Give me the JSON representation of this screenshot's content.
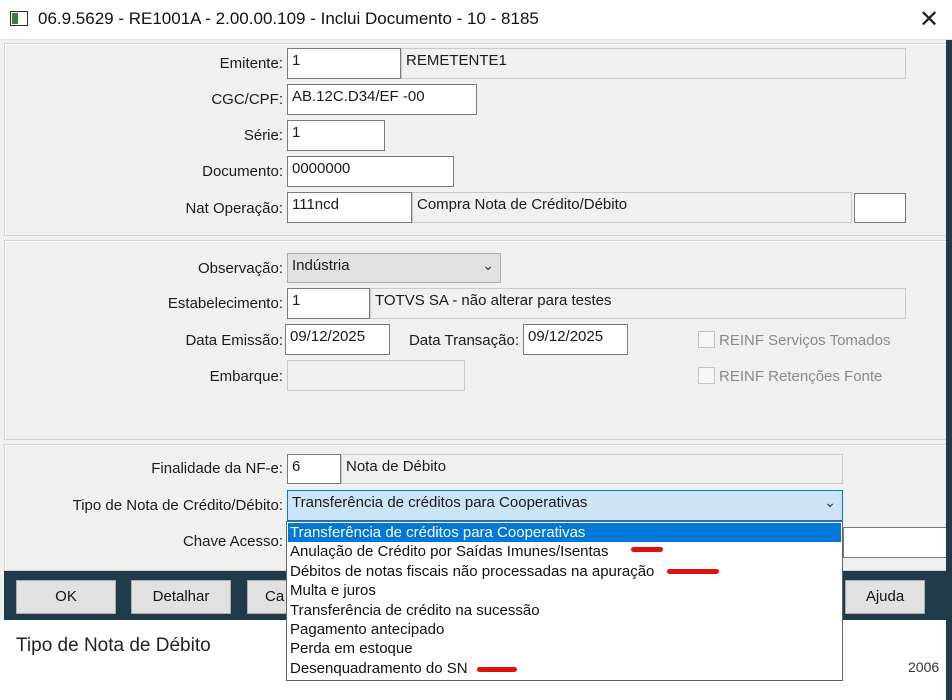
{
  "window": {
    "title": "06.9.5629 - RE1001A - 2.00.00.109 - Inclui Documento - 10 - 8185",
    "close_glyph": "✕"
  },
  "section1": {
    "emitente": {
      "label": "Emitente:",
      "value": "1",
      "name": "REMETENTE1"
    },
    "cgc": {
      "label": "CGC/CPF:",
      "value": "AB.12C.D34/EF  -00"
    },
    "serie": {
      "label": "Série:",
      "value": "1"
    },
    "documento": {
      "label": "Documento:",
      "value": "0000000"
    },
    "nat_operacao": {
      "label": "Nat Operação:",
      "value": "111ncd",
      "desc": "Compra Nota de Crédito/Débito",
      "extra": ""
    }
  },
  "section2": {
    "observacao": {
      "label": "Observação:",
      "value": "Indústria"
    },
    "estabelecimento": {
      "label": "Estabelecimento:",
      "value": "1",
      "desc": "TOTVS SA - não alterar para testes"
    },
    "data_emissao": {
      "label": "Data Emissão:",
      "value": "09/12/2025"
    },
    "data_transacao": {
      "label": "Data Transação:",
      "value": "09/12/2025"
    },
    "embarque": {
      "label": "Embarque:",
      "value": ""
    },
    "reinf_servicos": {
      "label": "REINF Serviços Tomados",
      "checked": false
    },
    "reinf_retencoes": {
      "label": "REINF Retenções Fonte",
      "checked": false
    }
  },
  "section3": {
    "finalidade": {
      "label": "Finalidade da NF-e:",
      "value": "6",
      "desc": "Nota de Débito"
    },
    "tipo_nota": {
      "label": "Tipo de Nota de Crédito/Débito:",
      "value": "Transferência de créditos para Cooperativas"
    },
    "chave_acesso": {
      "label": "Chave Acesso:"
    }
  },
  "buttons": {
    "ok": "OK",
    "detalhar": "Detalhar",
    "cancelar": "Ca",
    "ajuda": "Ajuda"
  },
  "dropdown": {
    "items": [
      "Transferência de créditos para Cooperativas",
      "Anulação de Crédito por Saídas Imunes/Isentas",
      "Débitos de notas fiscais não processadas na apuração",
      "Multa e juros",
      "Transferência de crédito na sucessão",
      "Pagamento antecipado",
      "Perda em estoque",
      "Desenquadramento do SN"
    ],
    "selected_index": 0,
    "highlight_color": "#0078d7",
    "annotation_color": "#e0100f"
  },
  "background": {
    "status_text": "Tipo de Nota de Débito",
    "right_fragment": "2006"
  }
}
